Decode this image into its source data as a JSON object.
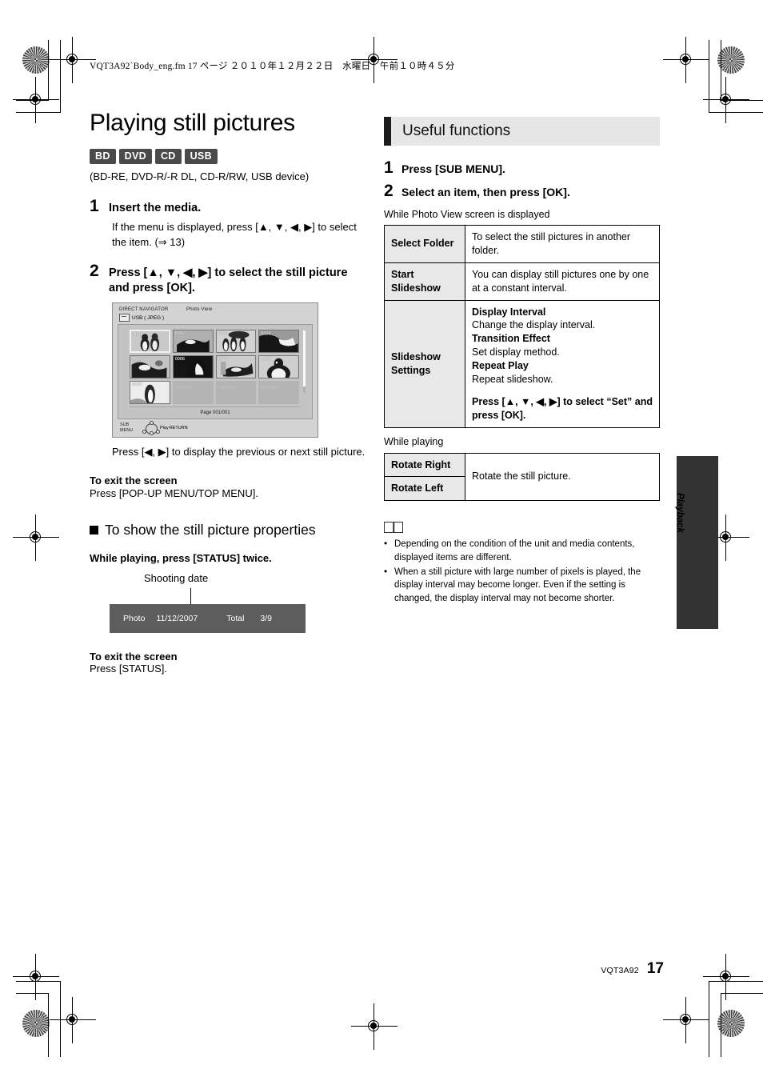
{
  "print_slug": "VQT3A92`Body_eng.fm  17 ページ  ２０１０年１２月２２日　水曜日　午前１０時４５分",
  "left": {
    "title": "Playing still pictures",
    "badges": [
      "BD",
      "DVD",
      "CD",
      "USB"
    ],
    "media_line": "(BD-RE, DVD-R/-R DL, CD-R/RW, USB device)",
    "step1": {
      "num": "1",
      "heading": "Insert the media.",
      "body": "If the menu is displayed, press [▲, ▼, ◀, ▶] to select the item. (⇒ 13)"
    },
    "step2": {
      "num": "2",
      "heading": "Press [▲, ▼, ◀, ▶] to select the still picture and press [OK]."
    },
    "screen": {
      "title": "DIRECT NAVIGATOR",
      "mode": "Photo View",
      "source": "USB ( JPEG )",
      "thumbnails": [
        "0001",
        "0002",
        "0003",
        "0004",
        "0005",
        "0006",
        "0007",
        "0008",
        "0009"
      ],
      "page_label": "Page  001/001",
      "submenu_label_1": "SUB",
      "submenu_label_2": "MENU",
      "play_label": "Play",
      "return_label": "RETURN"
    },
    "caption": "Press [◀, ▶] to display the previous or next still picture.",
    "exit1_head": "To exit the screen",
    "exit1_text": "Press [POP-UP MENU/TOP MENU].",
    "section2_title": "To show the still picture properties",
    "section2_bold": "While playing, press [STATUS] twice.",
    "shooting_date_label": "Shooting date",
    "status_bar": {
      "photo": "Photo",
      "date": "11/12/2007",
      "total_label": "Total",
      "count": "3/9"
    },
    "exit2_head": "To exit the screen",
    "exit2_text": "Press [STATUS]."
  },
  "right": {
    "panel_title": "Useful functions",
    "step1": {
      "num": "1",
      "text": "Press [SUB MENU]."
    },
    "step2": {
      "num": "2",
      "text": "Select an item, then press [OK]."
    },
    "table1_intro": "While Photo View screen is displayed",
    "table1": [
      {
        "key": "Select Folder",
        "value": "To select the still pictures in another folder."
      },
      {
        "key": "Start Slideshow",
        "value": "You can display still pictures one by one at a constant interval."
      }
    ],
    "slideshow": {
      "key": "Slideshow Settings",
      "rows": [
        {
          "bold": "Display Interval",
          "text": "Change the display interval."
        },
        {
          "bold": "Transition Effect",
          "text": "Set display method."
        },
        {
          "bold": "Repeat Play",
          "text": "Repeat slideshow."
        }
      ],
      "footer": "Press [▲, ▼, ◀, ▶] to select “Set” and press [OK]."
    },
    "table2_intro": "While playing",
    "table2": {
      "key1": "Rotate Right",
      "key2": "Rotate Left",
      "value": "Rotate the still picture."
    },
    "notes": [
      "Depending on the condition of the unit and media contents, displayed items are different.",
      "When a still picture with large number of pixels is played, the display interval may become longer. Even if the setting is changed, the display interval may not become shorter."
    ]
  },
  "side_tab_label": "Playback",
  "footer": {
    "code": "VQT3A92",
    "page": "17"
  }
}
